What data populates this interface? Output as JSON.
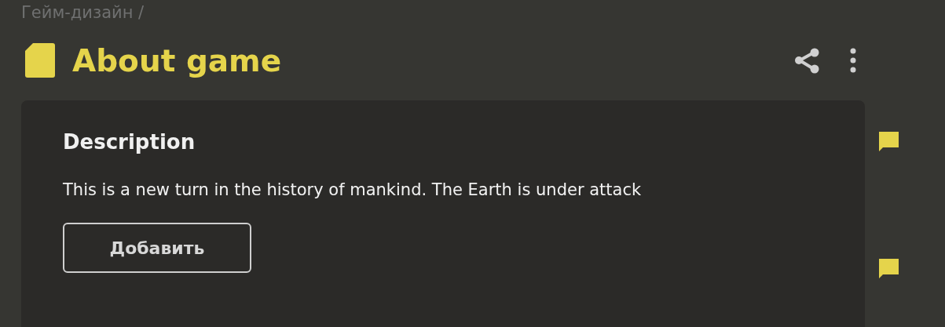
{
  "breadcrumb": "Гейм-дизайн /",
  "title": "About game",
  "section": {
    "heading": "Description",
    "text": "This is a new turn in the history of mankind. The Earth is under attack",
    "button": "Добавить"
  },
  "comments": [
    {
      "kind": "comment"
    },
    {
      "kind": "comment"
    }
  ]
}
